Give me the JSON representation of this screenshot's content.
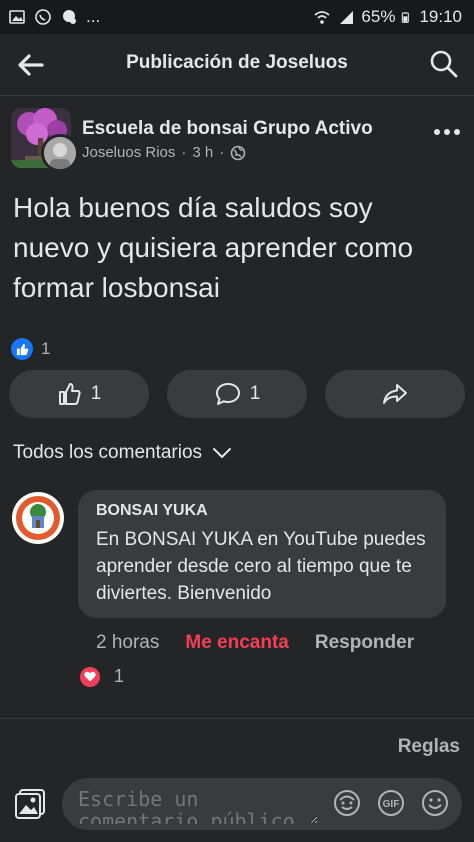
{
  "status_bar": {
    "battery": "65%",
    "time": "19:10",
    "left_icons": [
      "image-icon",
      "whatsapp-icon",
      "chat-icon",
      "more-dots"
    ],
    "more": "..."
  },
  "topbar": {
    "title": "Publicación de Joseluos"
  },
  "post": {
    "group_name": "Escuela de bonsai Grupo Activo",
    "author": "Joseluos Rios",
    "time": "3 h",
    "separator": "·",
    "text": "Hola buenos día saludos soy nuevo y quisiera aprender como formar losbonsai",
    "reaction_count": "1",
    "actions": {
      "like_count": "1",
      "comment_count": "1"
    }
  },
  "comments_filter": {
    "label": "Todos los comentarios"
  },
  "comment": {
    "author": "BONSAI YUKA",
    "text": "En BONSAI YUKA en YouTube puedes aprender desde cero al tiempo que te diviertes. Bienvenido",
    "time": "2 horas",
    "love_label": "Me encanta",
    "reply_label": "Responder",
    "reaction_count": "1"
  },
  "rules_label": "Reglas",
  "composer": {
    "placeholder": "Escribe un comentario público"
  },
  "colors": {
    "background": "#242526",
    "bubble": "#3a3b3c",
    "accent_blue": "#1877f2",
    "love_red": "#f33e58"
  }
}
